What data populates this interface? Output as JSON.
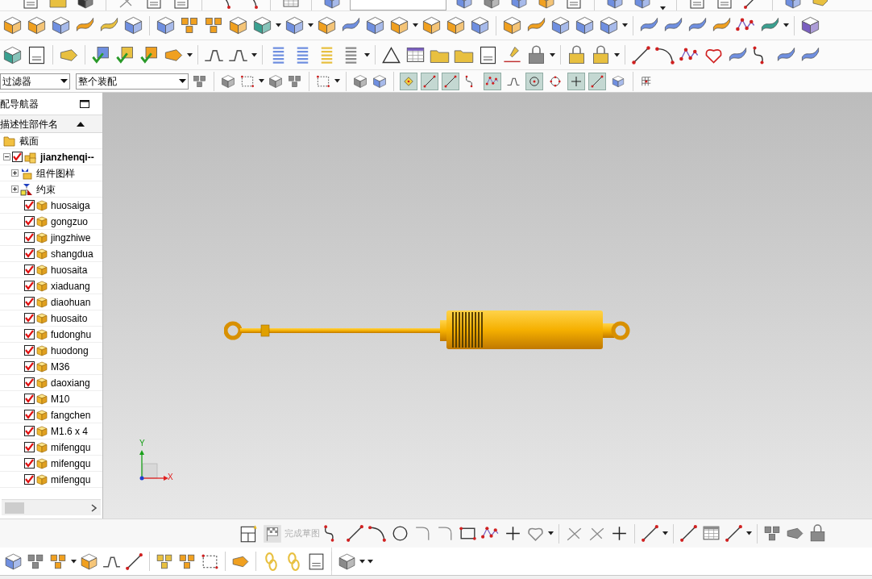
{
  "selection_bar": {
    "filter": "过滤器",
    "scope": "整个装配",
    "snap_points": [
      {
        "selected": true
      },
      {
        "selected": true
      },
      {
        "selected": true
      },
      {
        "selected": false
      },
      {
        "selected": true
      },
      {
        "selected": false
      },
      {
        "selected": true
      },
      {
        "selected": false
      },
      {
        "selected": true
      },
      {
        "selected": true
      },
      {
        "selected": false
      }
    ]
  },
  "navigator": {
    "title": "配导航器",
    "column": "描述性部件名",
    "tree": [
      {
        "label": "截面",
        "kind": "folder"
      },
      {
        "label": "jianzhenqi--",
        "kind": "assembly",
        "checked": true,
        "expanded": true,
        "children": [
          {
            "label": "组件图样",
            "kind": "drawings",
            "expanded": false
          },
          {
            "label": "约束",
            "kind": "constraints",
            "expanded": false
          },
          {
            "label": "huosaiga",
            "kind": "part",
            "checked": true
          },
          {
            "label": "gongzuo",
            "kind": "part",
            "checked": true
          },
          {
            "label": "jingzhiwe",
            "kind": "part",
            "checked": true
          },
          {
            "label": "shangdua",
            "kind": "part",
            "checked": true
          },
          {
            "label": "huosaita",
            "kind": "part",
            "checked": true
          },
          {
            "label": "xiaduang",
            "kind": "part",
            "checked": true
          },
          {
            "label": "diaohuan",
            "kind": "part",
            "checked": true
          },
          {
            "label": "huosaito",
            "kind": "part",
            "checked": true
          },
          {
            "label": "fudonghu",
            "kind": "part",
            "checked": true
          },
          {
            "label": "huodong",
            "kind": "part",
            "checked": true
          },
          {
            "label": "M36",
            "kind": "part",
            "checked": true
          },
          {
            "label": "daoxiang",
            "kind": "part",
            "checked": true
          },
          {
            "label": "M10",
            "kind": "part",
            "checked": true
          },
          {
            "label": "fangchen",
            "kind": "part",
            "checked": true
          },
          {
            "label": "M1.6 x 4",
            "kind": "part",
            "checked": true
          },
          {
            "label": "mifengqu",
            "kind": "part",
            "checked": true
          },
          {
            "label": "mifengqu",
            "kind": "part",
            "checked": true
          },
          {
            "label": "mifengqu",
            "kind": "part",
            "checked": true
          }
        ]
      }
    ]
  },
  "viewport": {
    "axis_labels": [
      "X",
      "Y"
    ]
  },
  "sketch_toolbar": {
    "finish_label": "完成草图",
    "finish_disabled": true
  }
}
